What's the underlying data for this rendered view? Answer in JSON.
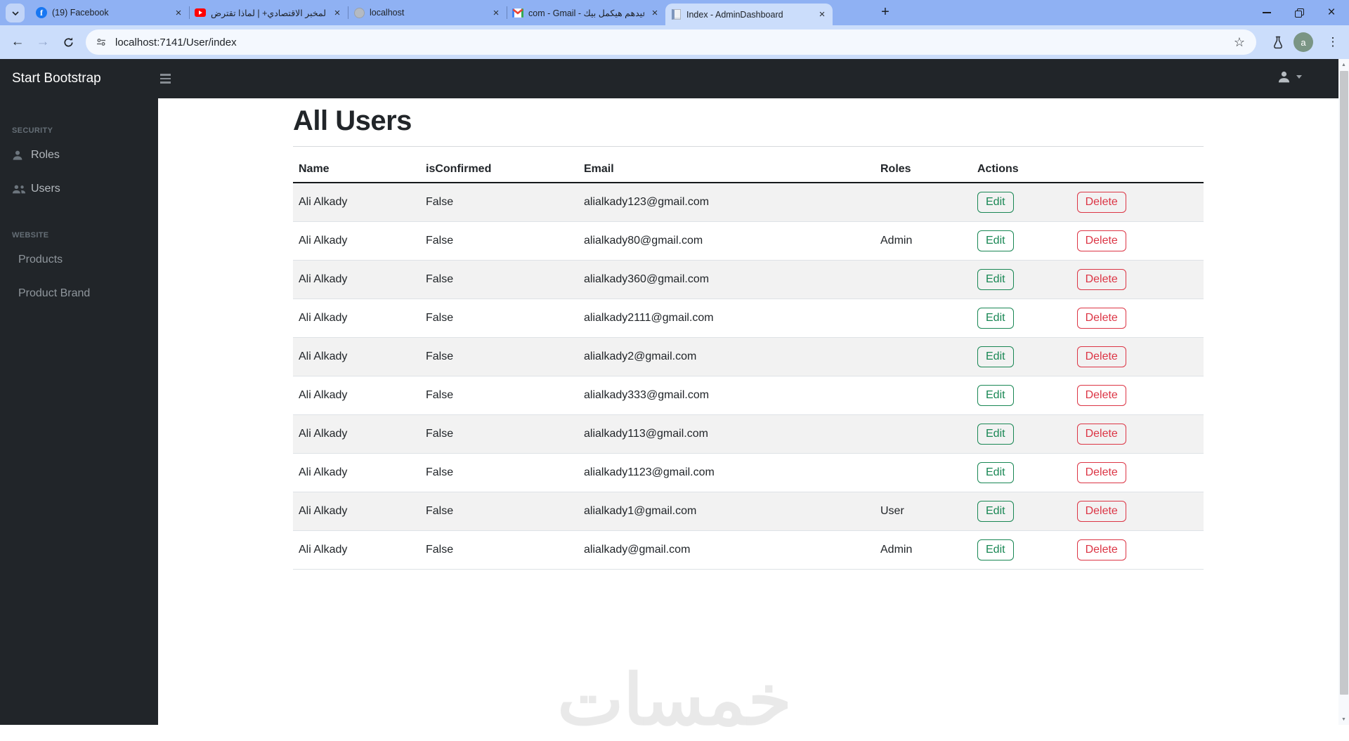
{
  "browser": {
    "tabs": [
      {
        "title": "(19) Facebook",
        "favicon": "facebook",
        "active": false
      },
      {
        "title": "المخبر الاقتصادي+ | لماذا تقترض",
        "favicon": "youtube",
        "active": false
      },
      {
        "title": "localhost",
        "favicon": "globe",
        "active": false
      },
      {
        "title": "com - Gmail - عيدهم هيكمل بيك",
        "favicon": "gmail",
        "active": false
      },
      {
        "title": "Index - AdminDashboard",
        "favicon": "document",
        "active": true
      }
    ],
    "url": "localhost:7141/User/index",
    "profile_initial": "a"
  },
  "navbar": {
    "brand": "Start Bootstrap"
  },
  "sidebar": {
    "sections": [
      {
        "heading": "SECURITY",
        "items": [
          {
            "label": "Roles",
            "icon": "person-icon"
          },
          {
            "label": "Users",
            "icon": "people-icon"
          }
        ]
      },
      {
        "heading": "WEBSITE",
        "items": [
          {
            "label": "Products"
          },
          {
            "label": "Product Brand"
          }
        ]
      }
    ]
  },
  "main": {
    "title": "All Users",
    "table": {
      "headers": [
        "Name",
        "isConfirmed",
        "Email",
        "Roles",
        "Actions"
      ],
      "actions": {
        "edit": "Edit",
        "delete": "Delete"
      },
      "rows": [
        {
          "name": "Ali Alkady",
          "is_confirmed": "False",
          "email": "alialkady123@gmail.com",
          "roles": ""
        },
        {
          "name": "Ali Alkady",
          "is_confirmed": "False",
          "email": "alialkady80@gmail.com",
          "roles": "Admin"
        },
        {
          "name": "Ali Alkady",
          "is_confirmed": "False",
          "email": "alialkady360@gmail.com",
          "roles": ""
        },
        {
          "name": "Ali Alkady",
          "is_confirmed": "False",
          "email": "alialkady2111@gmail.com",
          "roles": ""
        },
        {
          "name": "Ali Alkady",
          "is_confirmed": "False",
          "email": "alialkady2@gmail.com",
          "roles": ""
        },
        {
          "name": "Ali Alkady",
          "is_confirmed": "False",
          "email": "alialkady333@gmail.com",
          "roles": ""
        },
        {
          "name": "Ali Alkady",
          "is_confirmed": "False",
          "email": "alialkady113@gmail.com",
          "roles": ""
        },
        {
          "name": "Ali Alkady",
          "is_confirmed": "False",
          "email": "alialkady1123@gmail.com",
          "roles": ""
        },
        {
          "name": "Ali Alkady",
          "is_confirmed": "False",
          "email": "alialkady1@gmail.com",
          "roles": "User"
        },
        {
          "name": "Ali Alkady",
          "is_confirmed": "False",
          "email": "alialkady@gmail.com",
          "roles": "Admin"
        }
      ]
    },
    "watermark": "خمسات"
  },
  "colors": {
    "tab_strip_bg": "#8fb1f3",
    "toolbar_bg": "#cbddfb",
    "url_bar_bg": "#f4f8fe",
    "navbar_bg": "#212529",
    "sidebar_bg": "#212529",
    "edit_green": "#198754",
    "delete_red": "#dc3545",
    "row_stripe": "#f2f2f2",
    "watermark_gray": "#e9e9e9",
    "avatar_bg": "#7a9584",
    "facebook_blue": "#1877f2",
    "youtube_red": "#ff0000"
  }
}
